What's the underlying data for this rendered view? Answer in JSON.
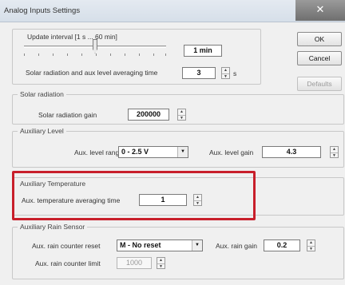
{
  "window": {
    "title": "Analog Inputs Settings",
    "close_glyph": "✕"
  },
  "buttons": {
    "ok": "OK",
    "cancel": "Cancel",
    "defaults": "Defaults"
  },
  "general": {
    "update_interval_label": "Update interval [1 s ... 60 min]",
    "update_interval_value": "1 min",
    "averaging_label": "Solar radiation and aux level averaging time",
    "averaging_value": "3",
    "averaging_unit": "s"
  },
  "solar": {
    "title": "Solar radiation",
    "gain_label": "Solar radiation gain",
    "gain_value": "200000"
  },
  "aux_level": {
    "title": "Auxiliary Level",
    "range_label": "Aux. level range",
    "range_value": "0 - 2.5 V",
    "gain_label": "Aux. level gain",
    "gain_value": "4.3"
  },
  "aux_temperature": {
    "title": "Auxiliary Temperature",
    "averaging_label": "Aux. temperature averaging time",
    "averaging_value": "1"
  },
  "aux_rain": {
    "title": "Auxiliary Rain Sensor",
    "reset_label": "Aux. rain counter reset",
    "reset_value": "M - No reset",
    "gain_label": "Aux. rain gain",
    "gain_value": "0.2",
    "limit_label": "Aux. rain counter limit",
    "limit_value": "1000"
  },
  "colors": {
    "highlight": "#c81f2b",
    "background": "#f0f0f0",
    "close_button": "#7a7a7a"
  },
  "icons": {
    "spinner": "spin-up-down-icon",
    "dropdown": "chevron-down-icon",
    "close": "close-icon"
  }
}
